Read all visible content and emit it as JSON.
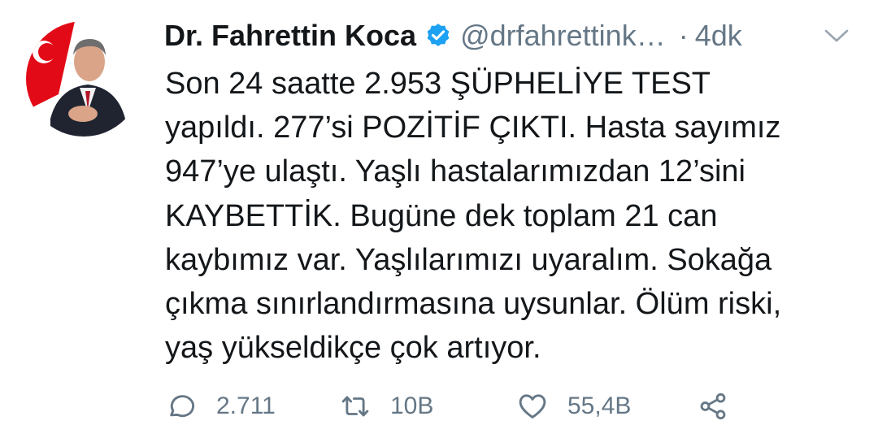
{
  "tweet": {
    "author_name": "Dr. Fahrettin Koca",
    "handle": "@drfahrettink…",
    "separator": "·",
    "time": "4dk",
    "lines": [
      "Son 24 saatte 2.953 ŞÜPHELİYE TEST",
      "yapıldı. 277’si POZİTİF ÇIKTI. Hasta sayımız",
      "947’ye ulaştı. Yaşlı hastalarımızdan 12’sini",
      "KAYBETTİK. Bugüne dek toplam 21 can",
      "kaybımız var. Yaşlılarımızı uyaralım. Sokağa",
      "çıkma sınırlandırmasına uysunlar. Ölüm riski,",
      "yaş yükseldikçe çok artıyor."
    ],
    "reply_count": "2.711",
    "retweet_count": "10B",
    "like_count": "55,4B"
  },
  "icons": {
    "verified": "verified-badge-icon",
    "caret": "chevron-down-icon",
    "reply": "reply-icon",
    "retweet": "retweet-icon",
    "like": "heart-icon",
    "share": "share-icon"
  },
  "colors": {
    "text": "#14171a",
    "secondary": "#657786",
    "verified": "#1da1f2"
  }
}
